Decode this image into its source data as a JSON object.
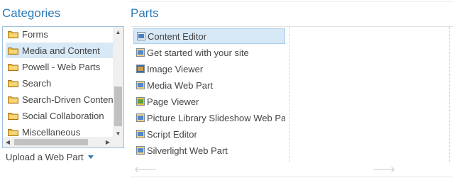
{
  "categories": {
    "heading": "Categories",
    "items": [
      {
        "label": "Forms",
        "selected": false
      },
      {
        "label": "Media and Content",
        "selected": true
      },
      {
        "label": "Powell - Web Parts",
        "selected": false
      },
      {
        "label": "Search",
        "selected": false
      },
      {
        "label": "Search-Driven Content",
        "selected": false
      },
      {
        "label": "Social Collaboration",
        "selected": false
      },
      {
        "label": "Miscellaneous",
        "selected": false
      }
    ],
    "upload_label": "Upload a Web Part"
  },
  "parts": {
    "heading": "Parts",
    "items": [
      {
        "label": "Content Editor",
        "icon": "content-editor-icon",
        "selected": true
      },
      {
        "label": "Get started with your site",
        "icon": "get-started-icon",
        "selected": false
      },
      {
        "label": "Image Viewer",
        "icon": "image-viewer-icon",
        "selected": false
      },
      {
        "label": "Media Web Part",
        "icon": "media-web-part-icon",
        "selected": false
      },
      {
        "label": "Page Viewer",
        "icon": "page-viewer-icon",
        "selected": false
      },
      {
        "label": "Picture Library Slideshow Web Part",
        "icon": "slideshow-icon",
        "selected": false
      },
      {
        "label": "Script Editor",
        "icon": "script-editor-icon",
        "selected": false
      },
      {
        "label": "Silverlight Web Part",
        "icon": "silverlight-icon",
        "selected": false
      }
    ]
  },
  "colors": {
    "heading": "#2a7ab8",
    "selection": "#d7e8f7",
    "folder": "#e8b73b"
  }
}
